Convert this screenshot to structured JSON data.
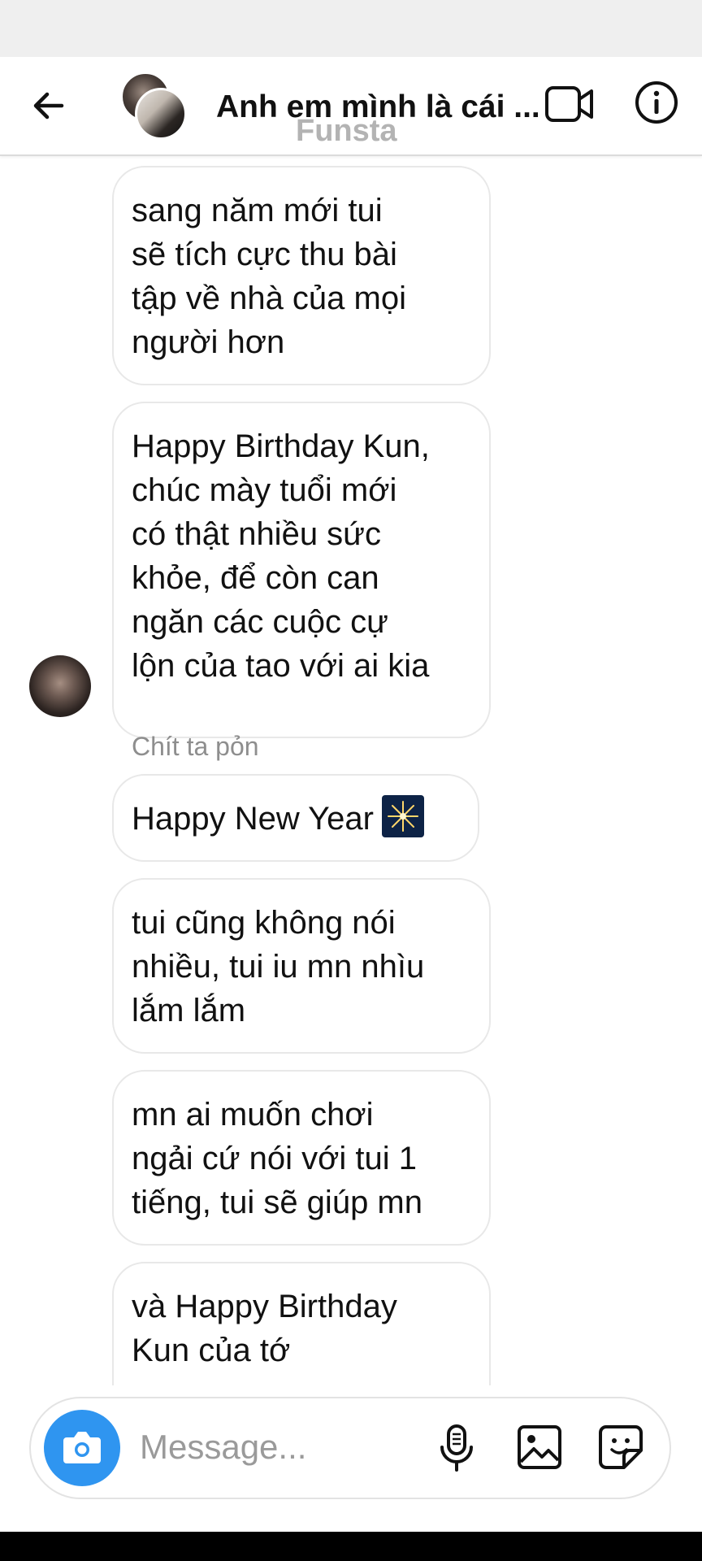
{
  "header": {
    "title": "Anh em mình là cái ...",
    "subtitle": "Funsta",
    "back_icon": "arrow-left-icon",
    "video_icon": "video-camera-icon",
    "info_icon": "info-icon"
  },
  "messages": [
    {
      "text": "sang năm mới tui\nsẽ tích cực thu bài\ntập về nhà của mọi\nngười hơn"
    },
    {
      "text": "Happy Birthday Kun,\nchúc mày tuổi mới\ncó thật nhiều sức\nkhỏe, để còn can\nngăn các cuộc cự\nlộn của tao với ai kia"
    },
    {
      "sender": "Chít ta pỏn",
      "text": "Happy New Year",
      "emoji": "fireworks-icon"
    },
    {
      "text": "tui cũng không nói\nnhiều, tui iu mn nhìu\nlắm lắm"
    },
    {
      "text": "mn ai muốn chơi\nngải cứ nói với tui 1\ntiếng, tui sẽ giúp mn"
    },
    {
      "text": "và Happy Birthday\nKun của tớ"
    }
  ],
  "composer": {
    "placeholder": "Message...",
    "value": "",
    "camera_icon": "camera-icon",
    "mic_icon": "microphone-icon",
    "gallery_icon": "image-icon",
    "sticker_icon": "sticker-icon"
  },
  "colors": {
    "accent": "#2f95f0",
    "bubble_border": "#e8e8e8",
    "secondary_text": "#8e8e8e"
  }
}
